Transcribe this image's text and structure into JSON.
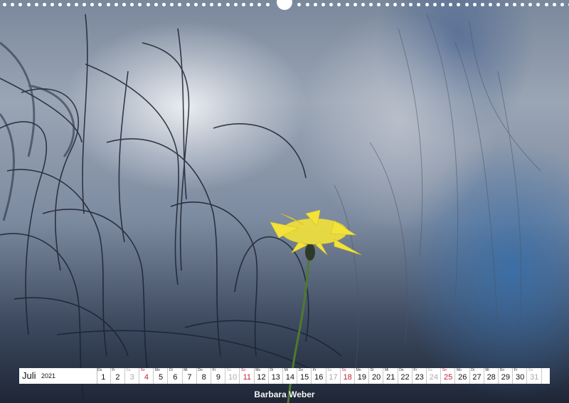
{
  "calendar": {
    "month": "Juli",
    "year": "2021",
    "days": [
      {
        "abbr": "Do",
        "num": "1",
        "kind": "weekday"
      },
      {
        "abbr": "Fr",
        "num": "2",
        "kind": "weekday"
      },
      {
        "abbr": "Sa",
        "num": "3",
        "kind": "sat"
      },
      {
        "abbr": "So",
        "num": "4",
        "kind": "sun"
      },
      {
        "abbr": "Mo",
        "num": "5",
        "kind": "weekday"
      },
      {
        "abbr": "Di",
        "num": "6",
        "kind": "weekday"
      },
      {
        "abbr": "Mi",
        "num": "7",
        "kind": "weekday"
      },
      {
        "abbr": "Do",
        "num": "8",
        "kind": "weekday"
      },
      {
        "abbr": "Fr",
        "num": "9",
        "kind": "weekday"
      },
      {
        "abbr": "Sa",
        "num": "10",
        "kind": "sat"
      },
      {
        "abbr": "So",
        "num": "11",
        "kind": "sun"
      },
      {
        "abbr": "Mo",
        "num": "12",
        "kind": "weekday"
      },
      {
        "abbr": "Di",
        "num": "13",
        "kind": "weekday"
      },
      {
        "abbr": "Mi",
        "num": "14",
        "kind": "weekday"
      },
      {
        "abbr": "Do",
        "num": "15",
        "kind": "weekday"
      },
      {
        "abbr": "Fr",
        "num": "16",
        "kind": "weekday"
      },
      {
        "abbr": "Sa",
        "num": "17",
        "kind": "sat"
      },
      {
        "abbr": "So",
        "num": "18",
        "kind": "sun"
      },
      {
        "abbr": "Mo",
        "num": "19",
        "kind": "weekday"
      },
      {
        "abbr": "Di",
        "num": "20",
        "kind": "weekday"
      },
      {
        "abbr": "Mi",
        "num": "21",
        "kind": "weekday"
      },
      {
        "abbr": "Do",
        "num": "22",
        "kind": "weekday"
      },
      {
        "abbr": "Fr",
        "num": "23",
        "kind": "weekday"
      },
      {
        "abbr": "Sa",
        "num": "24",
        "kind": "sat"
      },
      {
        "abbr": "So",
        "num": "25",
        "kind": "sun"
      },
      {
        "abbr": "Mo",
        "num": "26",
        "kind": "weekday"
      },
      {
        "abbr": "Di",
        "num": "27",
        "kind": "weekday"
      },
      {
        "abbr": "Mi",
        "num": "28",
        "kind": "weekday"
      },
      {
        "abbr": "Do",
        "num": "29",
        "kind": "weekday"
      },
      {
        "abbr": "Fr",
        "num": "30",
        "kind": "weekday"
      },
      {
        "abbr": "Sa",
        "num": "31",
        "kind": "sat"
      }
    ]
  },
  "author": "Barbara Weber",
  "colors": {
    "sunday": "#c0203a",
    "saturday": "#aaaaaa",
    "flower": "#f2e23a"
  }
}
